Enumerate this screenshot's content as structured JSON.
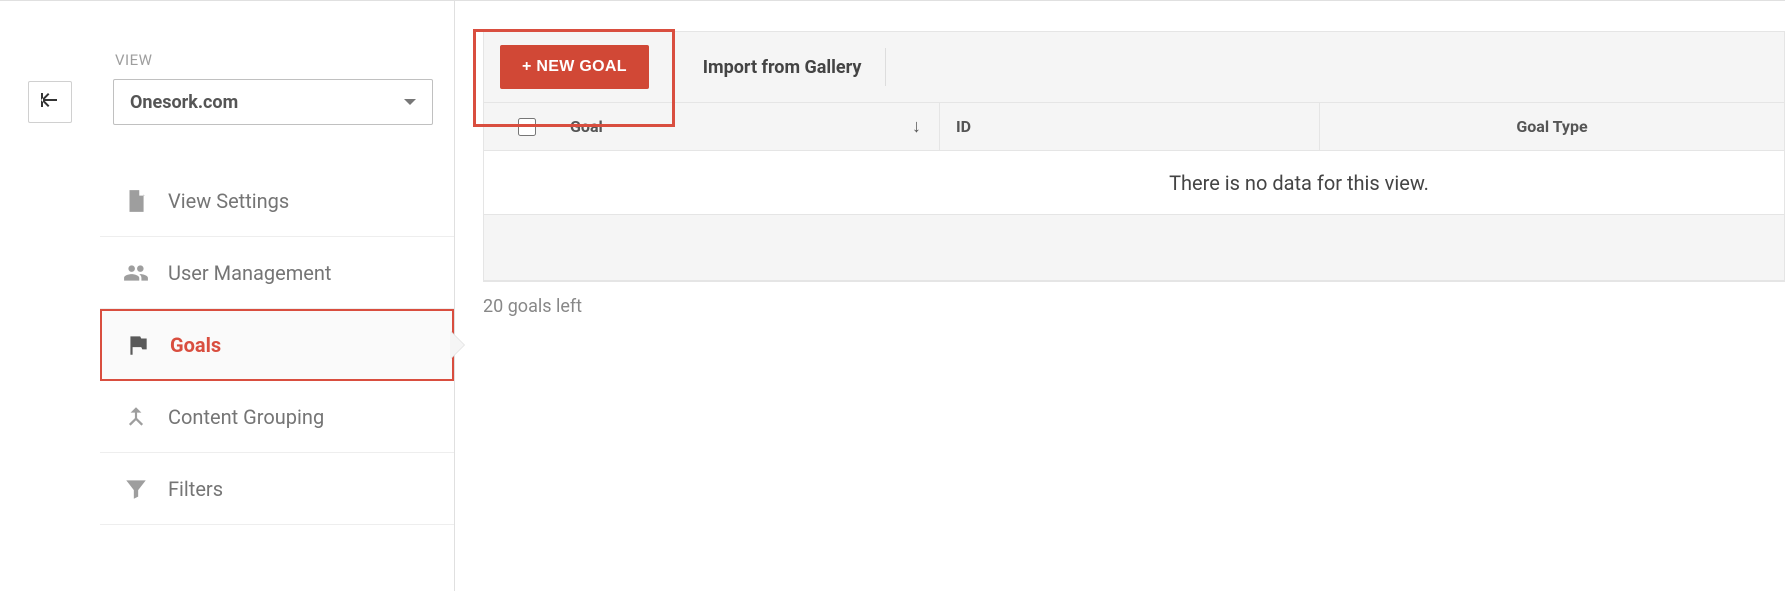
{
  "sidebar": {
    "view_label": "VIEW",
    "view_selected": "Onesork.com",
    "items": [
      {
        "label": "View Settings"
      },
      {
        "label": "User Management"
      },
      {
        "label": "Goals"
      },
      {
        "label": "Content Grouping"
      },
      {
        "label": "Filters"
      }
    ]
  },
  "toolbar": {
    "new_goal_label": "+ NEW GOAL",
    "import_label": "Import from Gallery"
  },
  "table": {
    "columns": {
      "goal": "Goal",
      "id": "ID",
      "goal_type": "Goal Type"
    },
    "empty_message": "There is no data for this view."
  },
  "footer": {
    "goals_left": "20 goals left"
  }
}
